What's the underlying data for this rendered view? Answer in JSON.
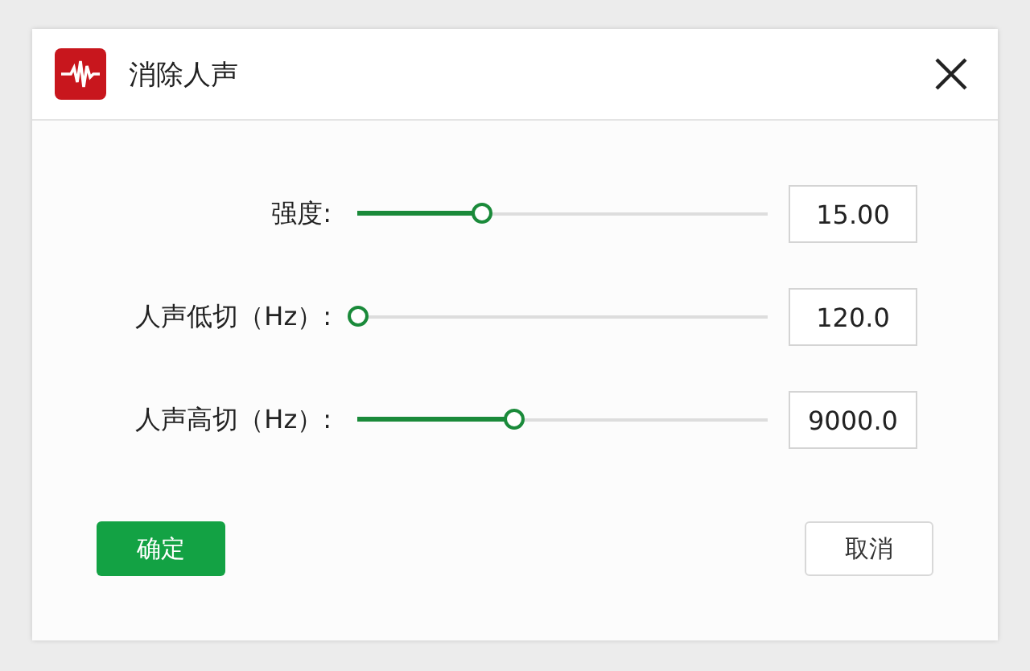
{
  "window": {
    "title": "消除人声"
  },
  "sliders": [
    {
      "label": "强度:",
      "level": 0.3,
      "value": "15.00"
    },
    {
      "label": "人声低切（Hz）:",
      "level": 0.0,
      "value": "120.0"
    },
    {
      "label": "人声高切（Hz）:",
      "level": 0.38,
      "value": "9000.0"
    }
  ],
  "buttons": {
    "confirm": "确定",
    "cancel": "取消"
  }
}
